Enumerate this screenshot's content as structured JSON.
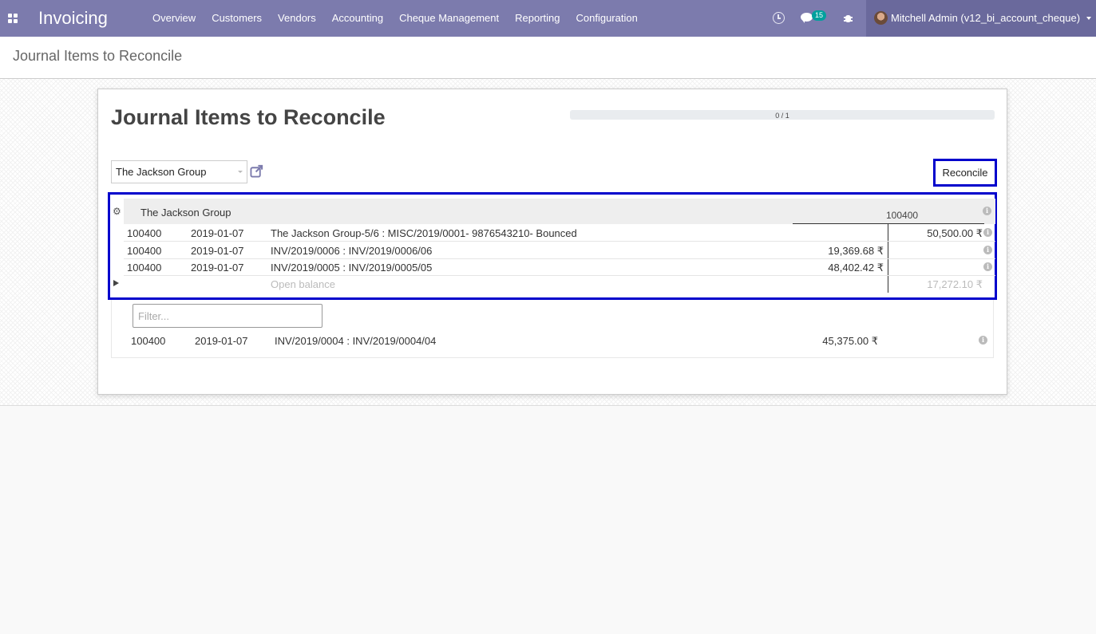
{
  "app": {
    "name": "Invoicing"
  },
  "menu": [
    "Overview",
    "Customers",
    "Vendors",
    "Accounting",
    "Cheque Management",
    "Reporting",
    "Configuration"
  ],
  "systray": {
    "messages_count": "15",
    "user": "Mitchell Admin (v12_bi_account_cheque)"
  },
  "breadcrumb": "Journal Items to Reconcile",
  "sheet": {
    "title": "Journal Items to Reconcile",
    "progress": {
      "label": "0 / 1",
      "value": 0
    },
    "partner": "The Jackson Group",
    "reconcile_label": "Reconcile"
  },
  "reconcile": {
    "partner": "The Jackson Group",
    "account": "100400",
    "lines": [
      {
        "account": "100400",
        "date": "2019-01-07",
        "label": "The Jackson Group-5/6 : MISC/2019/0001- 9876543210- Bounced",
        "debit": "",
        "credit": "50,500.00 ₹"
      },
      {
        "account": "100400",
        "date": "2019-01-07",
        "label": "INV/2019/0006 : INV/2019/0006/06",
        "debit": "19,369.68 ₹",
        "credit": ""
      },
      {
        "account": "100400",
        "date": "2019-01-07",
        "label": "INV/2019/0005 : INV/2019/0005/05",
        "debit": "48,402.42 ₹",
        "credit": ""
      }
    ],
    "open_balance": {
      "label": "Open balance",
      "credit": "17,272.10 ₹"
    }
  },
  "matching": {
    "filter_placeholder": "Filter...",
    "lines": [
      {
        "account": "100400",
        "date": "2019-01-07",
        "label": "INV/2019/0004 : INV/2019/0004/04",
        "debit": "45,375.00 ₹"
      }
    ]
  }
}
